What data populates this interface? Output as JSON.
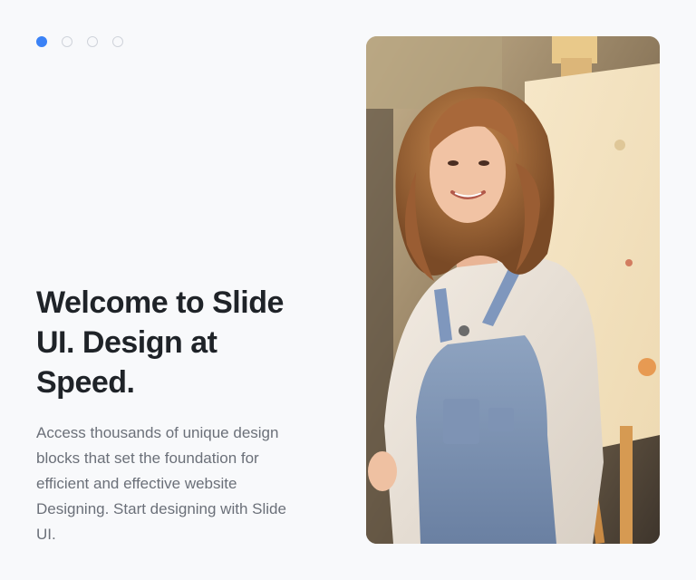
{
  "carousel": {
    "total_slides": 4,
    "active_index": 0
  },
  "hero": {
    "headline_line1": "Welcome to Slide",
    "headline_line2": "UI. Design at",
    "headline_line3": "Speed.",
    "description_line1": "Access thousands of unique design",
    "description_line2": "blocks that set the foundation for",
    "description_line3": "efficient and effective website",
    "description_line4": "Designing. Start designing with Slide",
    "description_line5": "UI."
  },
  "colors": {
    "accent": "#3b82f6",
    "headline": "#1f2328",
    "body_text": "#6b7079",
    "dot_inactive_border": "#cfd3da"
  }
}
